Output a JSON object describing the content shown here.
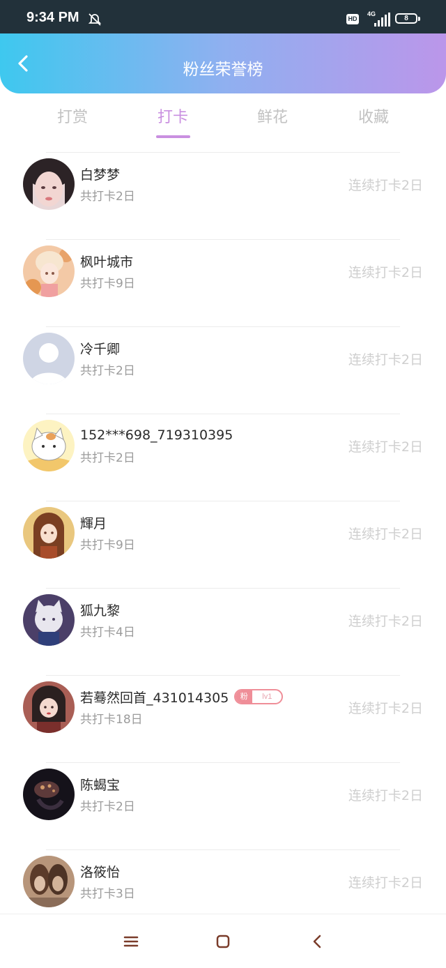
{
  "status_bar": {
    "time": "9:34 PM",
    "hd_label": "HD",
    "network": "4G",
    "battery": "8"
  },
  "header": {
    "title": "粉丝荣誉榜"
  },
  "tabs": [
    {
      "label": "打赏",
      "active": false
    },
    {
      "label": "打卡",
      "active": true
    },
    {
      "label": "鲜花",
      "active": false
    },
    {
      "label": "收藏",
      "active": false
    }
  ],
  "colors": {
    "accent": "#c98fe0",
    "header_gradient_start": "#3ec8ef",
    "header_gradient_end": "#bb96ea",
    "badge": "#ef8e98"
  },
  "fans": [
    {
      "name": "白梦梦",
      "total": "共打卡2日",
      "streak": "连续打卡2日"
    },
    {
      "name": "枫叶城市",
      "total": "共打卡9日",
      "streak": "连续打卡2日"
    },
    {
      "name": "冷千卿",
      "total": "共打卡2日",
      "streak": "连续打卡2日"
    },
    {
      "name": "152***698_719310395",
      "total": "共打卡2日",
      "streak": "连续打卡2日"
    },
    {
      "name": "輝月",
      "total": "共打卡9日",
      "streak": "连续打卡2日"
    },
    {
      "name": "狐九黎",
      "total": "共打卡4日",
      "streak": "连续打卡2日"
    },
    {
      "name": "若蓦然回首_431014305",
      "total": "共打卡18日",
      "streak": "连续打卡2日",
      "badge": {
        "label": "粉",
        "level": "lv1"
      }
    },
    {
      "name": "陈蝎宝",
      "total": "共打卡2日",
      "streak": "连续打卡2日"
    },
    {
      "name": "洛筱怡",
      "total": "共打卡3日",
      "streak": "连续打卡2日"
    }
  ],
  "nav": {
    "icons": [
      "menu-icon",
      "home-square-icon",
      "back-triangle-icon"
    ]
  }
}
